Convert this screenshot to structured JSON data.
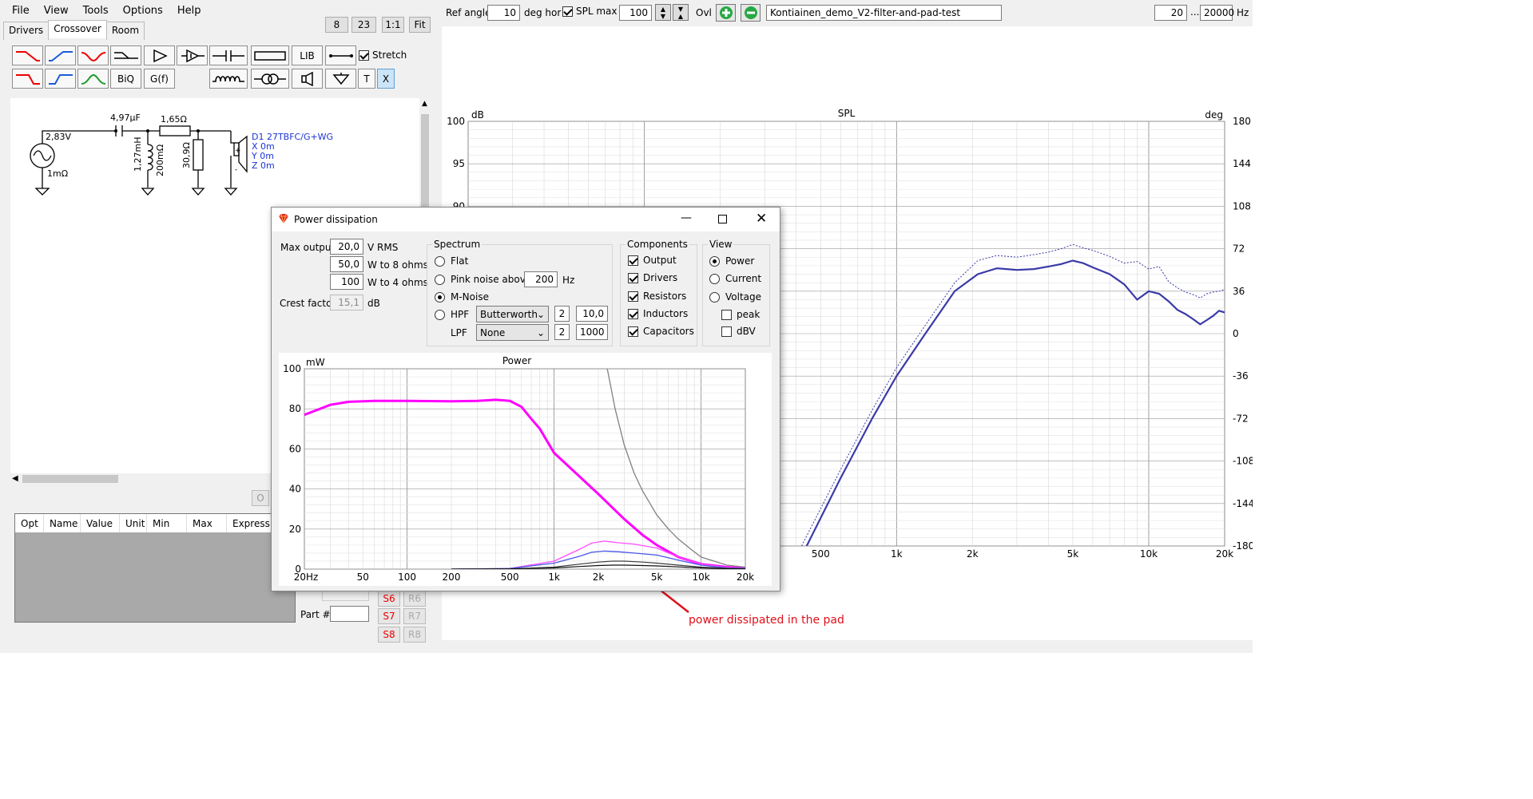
{
  "menu": [
    "File",
    "View",
    "Tools",
    "Options",
    "Help"
  ],
  "tabs": [
    "Drivers",
    "Crossover",
    "Room"
  ],
  "top_buttons": [
    "8",
    "23",
    "1:1",
    "Fit"
  ],
  "toolbar": {
    "biq": "BiQ",
    "gf": "G(f)",
    "lib": "LIB",
    "stretch": "Stretch",
    "t": "T",
    "x": "X"
  },
  "schematic": {
    "source_v": "2,83V",
    "source_r": "1mΩ",
    "cap": "4,97µF",
    "res_series": "1,65Ω",
    "inductor": "1,27mH",
    "inductor_r": "200mΩ",
    "res_shunt": "30,9Ω",
    "driver_name": "D1 27TBFC/G+WG",
    "driver_x": "X 0m",
    "driver_y": "Y 0m",
    "driver_z": "Z 0m"
  },
  "left_misc": {
    "o_btn": "O",
    "part_label": "Part #"
  },
  "param_table": {
    "headers": [
      "Opt",
      "Name",
      "Value",
      "Unit",
      "Min",
      "Max",
      "Expression"
    ]
  },
  "s_buttons": [
    {
      "s": "S6",
      "r": "R6"
    },
    {
      "s": "S7",
      "r": "R7"
    },
    {
      "s": "S8",
      "r": "R8"
    }
  ],
  "top_right": {
    "ref_angle_label": "Ref angle",
    "ref_angle": "10",
    "deg_hor": "deg hor",
    "spl_max_label": "SPL max",
    "spl_max": "100",
    "ovl": "Ovl",
    "project": "Kontiainen_demo_V2-filter-and-pad-test",
    "f_min": "20",
    "ellipsis": "...",
    "f_max": "20000",
    "hz": "Hz"
  },
  "dialog": {
    "title": "Power dissipation",
    "max_output_label": "Max output",
    "max_output": "20,0",
    "v_rms": "V  RMS",
    "w8": "50,0",
    "w8_label": "W to 8 ohms",
    "w4": "100",
    "w4_label": "W to 4 ohms",
    "crest_label": "Crest factor",
    "crest": "15,1",
    "db": "dB",
    "spectrum": {
      "title": "Spectrum",
      "flat": "Flat",
      "pink": "Pink noise above",
      "pink_hz": "200",
      "hz": "Hz",
      "mnoise": "M-Noise",
      "hpf": "HPF",
      "hpf_type": "Butterworth",
      "hpf_order": "2",
      "hpf_freq": "10,0",
      "lpf": "LPF",
      "lpf_type": "None",
      "lpf_order": "2",
      "lpf_freq": "1000"
    },
    "components": {
      "title": "Components",
      "items": [
        "Output",
        "Drivers",
        "Resistors",
        "Inductors",
        "Capacitors"
      ]
    },
    "view": {
      "title": "View",
      "power": "Power",
      "current": "Current",
      "voltage": "Voltage",
      "peak": "peak",
      "dbv": "dBV"
    }
  },
  "annotation": "power dissipated in the pad",
  "chart_data": [
    {
      "type": "line",
      "title": "SPL",
      "ylabel": "dB",
      "y2label": "deg",
      "xscale": "log",
      "xlim": [
        20,
        20000
      ],
      "ylim": [
        50,
        100
      ],
      "y2lim": [
        -180,
        180
      ],
      "x_ticks": [
        "500",
        "1k",
        "2k",
        "5k",
        "10k",
        "20k"
      ],
      "y_ticks": [
        100,
        95,
        90
      ],
      "y2_ticks": [
        180,
        144,
        108,
        72,
        36,
        0,
        -36,
        -72,
        -108,
        -144,
        -180
      ],
      "grid": true,
      "series": [
        {
          "color": "#3a3aa8",
          "style": "solid",
          "x": [
            440,
            600,
            800,
            1000,
            1300,
            1700,
            2100,
            2500,
            3000,
            3500,
            4000,
            4500,
            5000,
            5500,
            6000,
            7000,
            8000,
            9000,
            10000,
            11000,
            12000,
            13000,
            14000,
            15000,
            16000,
            17000,
            18000,
            19000,
            20000
          ],
          "y": [
            50,
            58,
            65,
            70,
            75,
            80,
            82,
            82.7,
            82.5,
            82.6,
            82.9,
            83.2,
            83.6,
            83.3,
            82.8,
            82.0,
            80.8,
            79.0,
            80.0,
            79.7,
            78.8,
            77.8,
            77.3,
            76.7,
            76.1,
            76.6,
            77.1,
            77.7,
            77.5
          ]
        },
        {
          "color": "#3a3aa8",
          "style": "dashed",
          "x": [
            420,
            600,
            800,
            1000,
            1300,
            1700,
            2100,
            2500,
            3000,
            3500,
            4000,
            4500,
            5000,
            5500,
            6000,
            7000,
            8000,
            9000,
            10000,
            11000,
            12000,
            13000,
            14000,
            15000,
            16000,
            17000,
            18000,
            19000,
            20000
          ],
          "y": [
            50,
            59,
            66,
            71,
            76,
            81,
            83.6,
            84.2,
            84.0,
            84.3,
            84.6,
            85.0,
            85.5,
            85.1,
            84.8,
            84.1,
            83.3,
            83.5,
            82.6,
            82.9,
            81.1,
            80.4,
            79.9,
            79.6,
            79.2,
            79.7,
            79.9,
            80.0,
            80.2
          ]
        }
      ]
    },
    {
      "type": "line",
      "title": "Power",
      "ylabel": "mW",
      "xscale": "log",
      "xlim": [
        20,
        20000
      ],
      "ylim": [
        0,
        100
      ],
      "x_ticks": [
        "20Hz",
        "50",
        "100",
        "200",
        "500",
        "1k",
        "2k",
        "5k",
        "10k",
        "20k"
      ],
      "y_ticks": [
        0,
        20,
        40,
        60,
        80,
        100
      ],
      "grid": true,
      "series": [
        {
          "color": "#ff00ff",
          "width": 3,
          "x": [
            20,
            30,
            40,
            60,
            100,
            200,
            300,
            400,
            500,
            600,
            700,
            800,
            1000,
            1500,
            2000,
            3000,
            4000,
            5000,
            7000,
            10000,
            15000,
            20000
          ],
          "y": [
            77,
            82,
            83.5,
            84,
            84,
            83.8,
            84,
            84.5,
            84,
            81,
            75,
            70,
            58,
            46,
            37.5,
            25,
            17,
            12,
            6,
            2.5,
            1,
            0.5
          ]
        },
        {
          "color": "#808080",
          "width": 1.3,
          "x": [
            2300,
            2600,
            3000,
            3500,
            4000,
            5000,
            6000,
            7000,
            8500,
            10000,
            15000,
            20000
          ],
          "y": [
            100,
            80,
            62,
            48,
            39,
            27,
            20,
            15,
            10,
            6,
            2,
            1
          ]
        },
        {
          "color": "#ff4dff",
          "width": 1.3,
          "x": [
            200,
            500,
            1000,
            1500,
            1800,
            2200,
            2700,
            3500,
            5000,
            7000,
            10000,
            15000,
            20000
          ],
          "y": [
            0,
            0.3,
            4,
            10,
            13,
            14,
            13.2,
            12.5,
            10.5,
            6,
            2.5,
            0.8,
            0.4
          ]
        },
        {
          "color": "#4a55e6",
          "width": 1.3,
          "x": [
            200,
            500,
            1000,
            1500,
            1800,
            2200,
            2700,
            3500,
            5000,
            7000,
            10000,
            15000,
            20000
          ],
          "y": [
            0,
            0.3,
            3,
            6.5,
            8.4,
            9,
            8.7,
            8,
            7,
            4.5,
            2,
            0.6,
            0.3
          ]
        },
        {
          "color": "#3d3d3d",
          "width": 1.2,
          "x": [
            200,
            500,
            1000,
            1500,
            2000,
            2500,
            3000,
            4000,
            5000,
            7000,
            10000,
            15000,
            20000
          ],
          "y": [
            0,
            0.1,
            1,
            2.5,
            3.5,
            4,
            4,
            3.5,
            3,
            2,
            1,
            0.4,
            0.2
          ]
        },
        {
          "color": "#111111",
          "width": 1.2,
          "x": [
            200,
            500,
            1000,
            1500,
            2000,
            2500,
            3000,
            4000,
            5000,
            7000,
            10000,
            15000,
            20000
          ],
          "y": [
            0,
            0.1,
            0.6,
            1.3,
            1.8,
            2,
            2,
            1.8,
            1.6,
            1.1,
            0.6,
            0.2,
            0.1
          ]
        }
      ]
    }
  ]
}
